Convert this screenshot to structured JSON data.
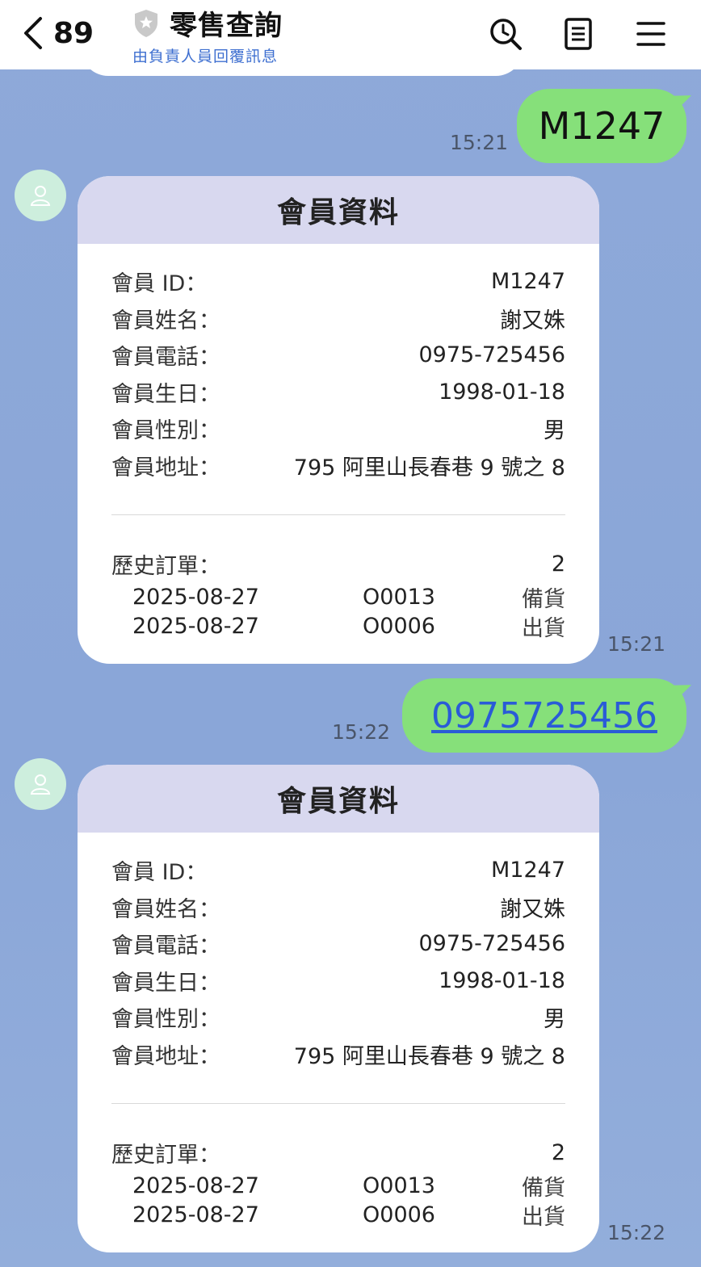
{
  "header": {
    "back_count": "89",
    "title": "零售查詢",
    "subtitle": "由負責人員回覆訊息"
  },
  "messages": [
    {
      "type": "outgoing",
      "text": "M1247",
      "time": "15:21"
    },
    {
      "type": "card",
      "time": "15:21",
      "title": "會員資料",
      "fields": [
        {
          "label": "會員 ID：",
          "value": "M1247"
        },
        {
          "label": "會員姓名：",
          "value": "謝又姝"
        },
        {
          "label": "會員電話：",
          "value": "0975-725456"
        },
        {
          "label": "會員生日：",
          "value": "1998-01-18"
        },
        {
          "label": "會員性別：",
          "value": "男"
        },
        {
          "label": "會員地址：",
          "value": "795 阿里山長春巷 9 號之 8"
        }
      ],
      "history_label": "歷史訂單：",
      "history_count": "2",
      "orders": [
        {
          "date": "2025-08-27",
          "no": "O0013",
          "status": "備貨"
        },
        {
          "date": "2025-08-27",
          "no": "O0006",
          "status": "出貨"
        }
      ]
    },
    {
      "type": "outgoing",
      "text": "0975725456",
      "time": "15:22"
    },
    {
      "type": "card",
      "time": "15:22",
      "title": "會員資料",
      "fields": [
        {
          "label": "會員 ID：",
          "value": "M1247"
        },
        {
          "label": "會員姓名：",
          "value": "謝又姝"
        },
        {
          "label": "會員電話：",
          "value": "0975-725456"
        },
        {
          "label": "會員生日：",
          "value": "1998-01-18"
        },
        {
          "label": "會員性別：",
          "value": "男"
        },
        {
          "label": "會員地址：",
          "value": "795 阿里山長春巷 9 號之 8"
        }
      ],
      "history_label": "歷史訂單：",
      "history_count": "2",
      "orders": [
        {
          "date": "2025-08-27",
          "no": "O0013",
          "status": "備貨"
        },
        {
          "date": "2025-08-27",
          "no": "O0006",
          "status": "出貨"
        }
      ]
    }
  ],
  "colors": {
    "chat_bg": "#8ea9d9",
    "outgoing_bubble": "#86e07a",
    "card_header": "#d8d8ef",
    "link": "#2a5bd7",
    "subtitle": "#3e6fd0"
  },
  "icons": [
    "back-icon",
    "shield-icon",
    "search-history-icon",
    "notes-icon",
    "menu-icon",
    "avatar-icon"
  ]
}
